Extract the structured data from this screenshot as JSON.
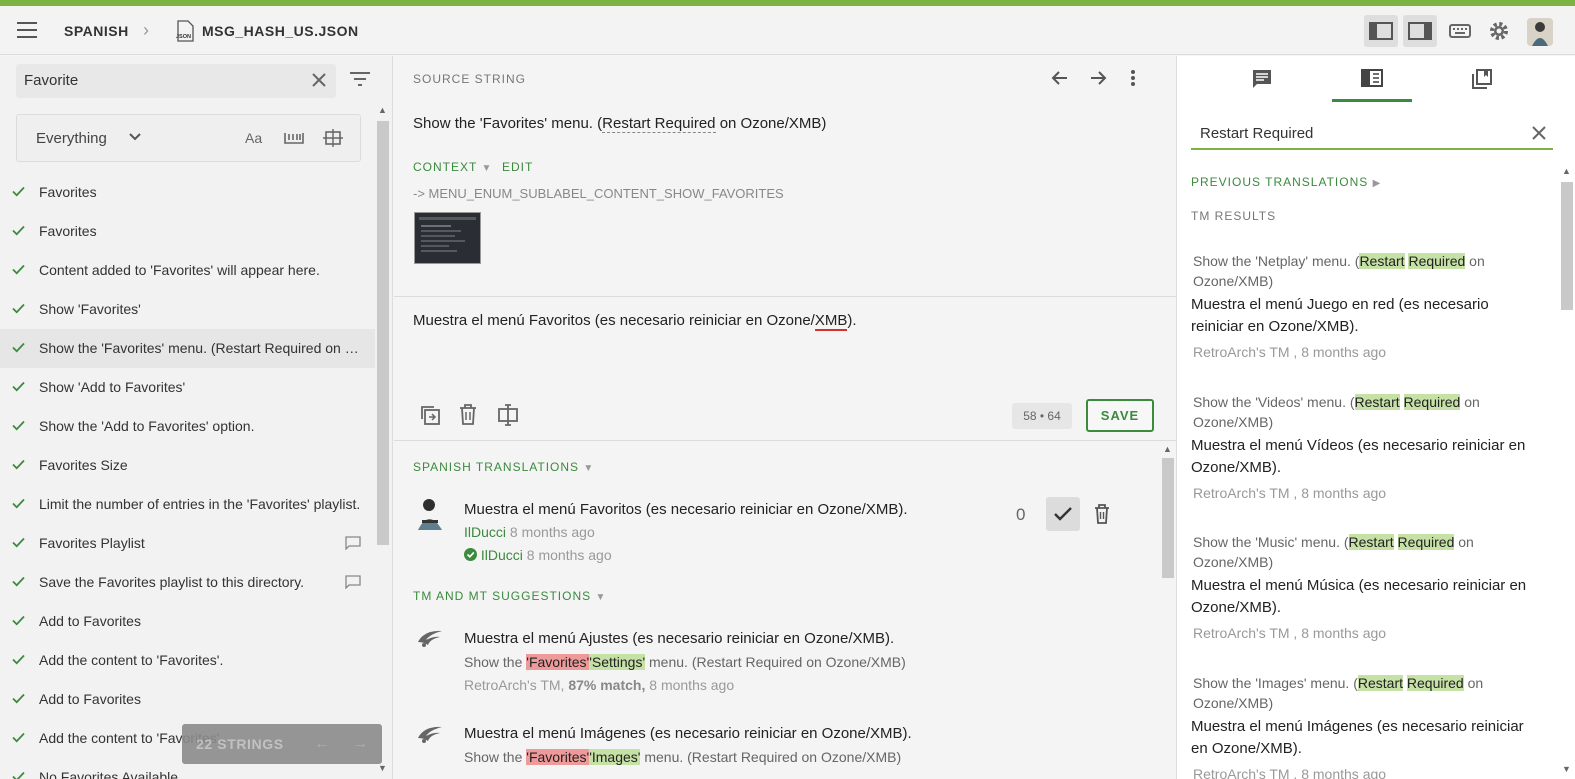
{
  "app": {
    "accent_color": "#3b8a3e",
    "stripe_color": "#7cb342"
  },
  "header": {
    "language": "SPANISH",
    "file_name": "MSG_HASH_US.JSON",
    "file_icon_text": "JSON",
    "separator": "›"
  },
  "sidebar": {
    "search_value": "Favorite",
    "filter_select": "Everything",
    "strings": [
      {
        "text": "Favorites",
        "comment": false
      },
      {
        "text": "Favorites",
        "comment": false
      },
      {
        "text": "Content added to 'Favorites' will appear here.",
        "comment": false
      },
      {
        "text": "Show 'Favorites'",
        "comment": false
      },
      {
        "text": "Show the 'Favorites' menu. (Restart Required on Ozone/XMB)",
        "comment": false
      },
      {
        "text": "Show 'Add to Favorites'",
        "comment": false
      },
      {
        "text": "Show the 'Add to Favorites' option.",
        "comment": false
      },
      {
        "text": "Favorites Size",
        "comment": false
      },
      {
        "text": "Limit the number of entries in the 'Favorites' playlist.",
        "comment": false
      },
      {
        "text": "Favorites Playlist",
        "comment": true
      },
      {
        "text": "Save the Favorites playlist to this directory.",
        "comment": true
      },
      {
        "text": "Add to Favorites",
        "comment": false
      },
      {
        "text": "Add the content to 'Favorites'.",
        "comment": false
      },
      {
        "text": "Add to Favorites",
        "comment": false
      },
      {
        "text": "Add the content to 'Favorites'.",
        "comment": false
      },
      {
        "text": "No Favorites Available",
        "comment": false
      }
    ],
    "count_label": "22 STRINGS"
  },
  "editor": {
    "source_label": "SOURCE STRING",
    "source_pre": "Show the 'Favorites' menu. (",
    "source_term": "Restart Required",
    "source_post": " on Ozone/XMB)",
    "context_label": "CONTEXT",
    "edit_label": "EDIT",
    "context_key": "-> MENU_ENUM_SUBLABEL_CONTENT_SHOW_FAVORITES",
    "translation_pre": "Muestra el menú Favoritos (es necesario reiniciar en Ozone/",
    "translation_err": "XMB",
    "translation_post": ").",
    "counter": "58 • 64",
    "save_label": "SAVE",
    "translations_label": "SPANISH TRANSLATIONS",
    "translation": {
      "text": "Muestra el menú Favoritos (es necesario reiniciar en Ozone/XMB).",
      "author": "IlDucci",
      "author_time": "8 months ago",
      "approver": "IlDucci",
      "approver_time": "8 months ago",
      "votes": "0"
    },
    "suggestions_label": "TM AND MT SUGGESTIONS",
    "suggestions": [
      {
        "text": "Muestra el menú Ajustes (es necesario reiniciar en Ozone/XMB).",
        "src_pre": "Show the ",
        "src_del": "'Favorites'",
        "src_ins": "'Settings'",
        "src_post": " menu. (Restart Required on Ozone/XMB)",
        "source": "RetroArch's TM,",
        "match": "87% match,",
        "time": "8 months ago"
      },
      {
        "text": "Muestra el menú Imágenes (es necesario reiniciar en Ozone/XMB).",
        "src_pre": "Show the ",
        "src_del": "'Favorites'",
        "src_ins": "'Images'",
        "src_post": " menu. (Restart Required on Ozone/XMB)"
      }
    ]
  },
  "right_panel": {
    "search_value": "Restart Required",
    "previous_label": "PREVIOUS TRANSLATIONS",
    "tm_label": "TM RESULTS",
    "hl_word_1": "Restart",
    "hl_word_2": "Required",
    "results": [
      {
        "src_pre": "Show the 'Netplay' menu. (",
        "src_post": " on",
        "src_line2": "Ozone/XMB)",
        "target": "Muestra el menú Juego en red (es necesario reiniciar en Ozone/XMB).",
        "meta": "RetroArch's TM , 8 months ago"
      },
      {
        "src_pre": "Show the 'Videos' menu. (",
        "src_post": " on",
        "src_line2": "Ozone/XMB)",
        "target": "Muestra el menú Vídeos (es necesario reiniciar en Ozone/XMB).",
        "meta": "RetroArch's TM , 8 months ago"
      },
      {
        "src_pre": "Show the 'Music' menu. (",
        "src_post": " on",
        "src_line2": "Ozone/XMB)",
        "target": "Muestra el menú Música (es necesario reiniciar en Ozone/XMB).",
        "meta": "RetroArch's TM , 8 months ago"
      },
      {
        "src_pre": "Show the 'Images' menu. (",
        "src_post": " on",
        "src_line2": "Ozone/XMB)",
        "target": "Muestra el menú Imágenes (es necesario reiniciar en Ozone/XMB).",
        "meta": "RetroArch's TM , 8 months ago"
      }
    ]
  }
}
